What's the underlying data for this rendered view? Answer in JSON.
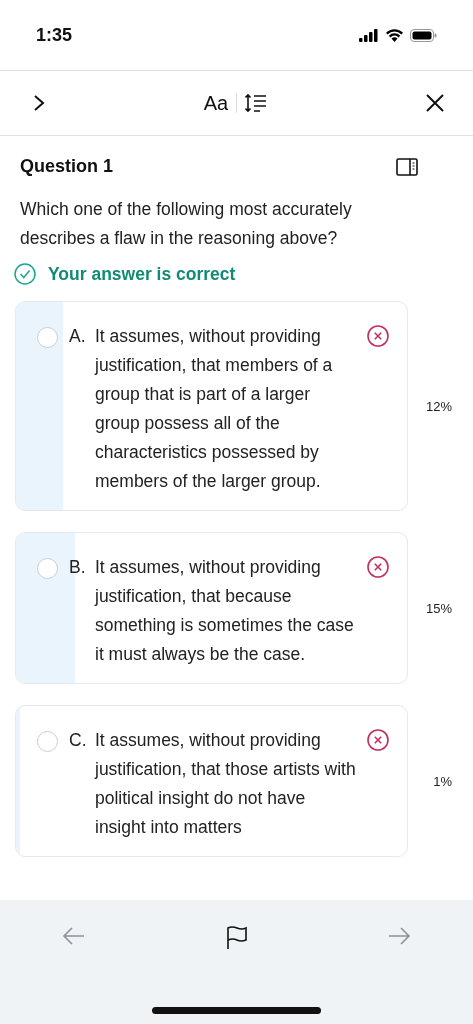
{
  "status_bar": {
    "time": "1:35"
  },
  "toolbar": {
    "font_label": "Aa"
  },
  "question": {
    "title": "Question 1",
    "prompt": "Which one of the following most accurately describes a flaw in the reasoning above?"
  },
  "result": {
    "text": "Your answer is correct",
    "correct": true
  },
  "options": [
    {
      "letter": "A.",
      "text": "It assumes, without providing justification, that members of a group that is part of a larger group possess all of the characteristics possessed by members of the larger group.",
      "selected": false,
      "wrong": true,
      "level": 0.12,
      "percent": "12%"
    },
    {
      "letter": "B.",
      "text": "It assumes, without providing justification, that because something is sometimes the case it must always be the case.",
      "selected": false,
      "wrong": true,
      "level": 0.15,
      "percent": "15%"
    },
    {
      "letter": "C.",
      "text": "It assumes, without providing justification, that those artists with political insight do not have insight into matters",
      "selected": false,
      "wrong": true,
      "level": 0.01,
      "percent": "1%"
    }
  ]
}
